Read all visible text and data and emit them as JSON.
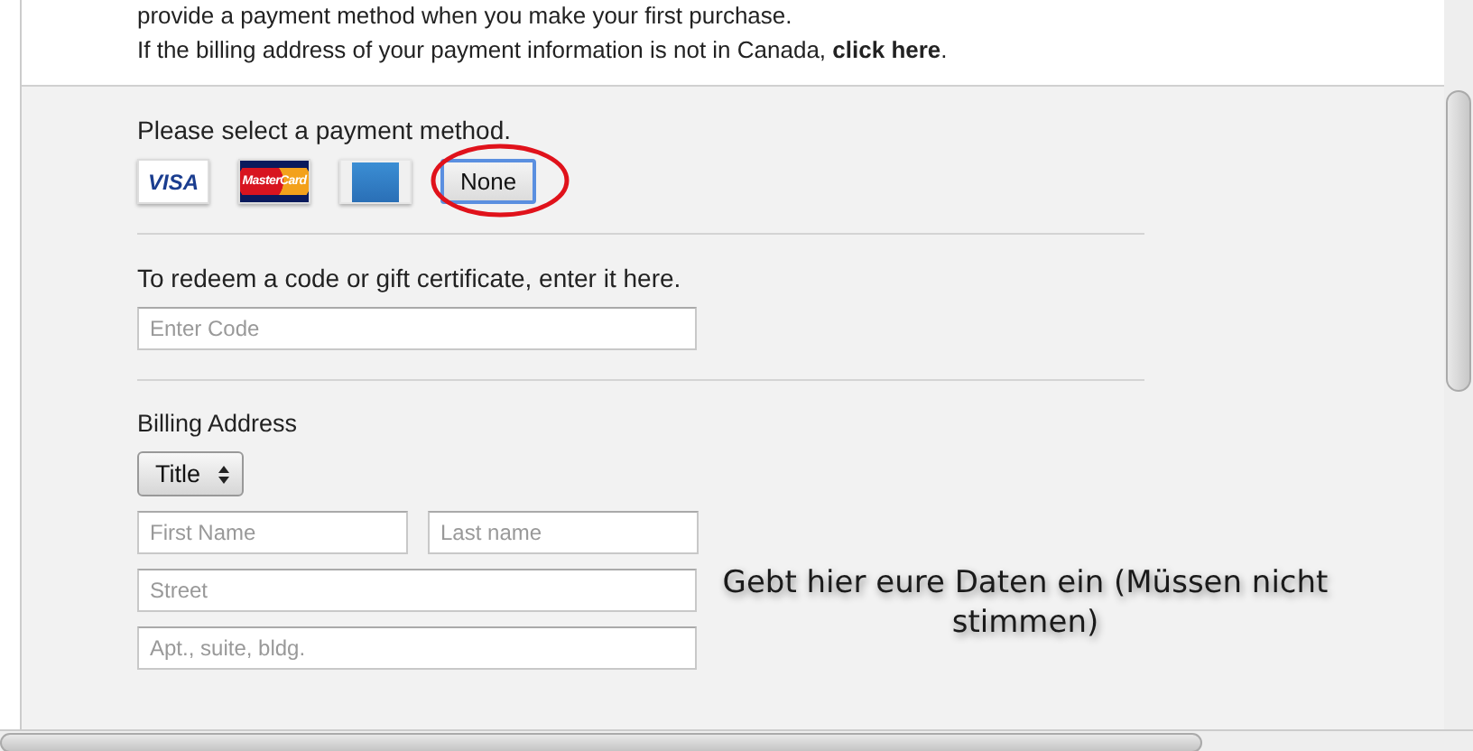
{
  "intro": {
    "line_1": "provide a payment method when you make your first purchase.",
    "line_2": "If the billing address of your payment information is not in Canada, **click here**."
  },
  "payment": {
    "label": "Please select a payment method.",
    "methods": [
      {
        "kind": "visa",
        "label": "VISA",
        "selected": false
      },
      {
        "kind": "mastercard",
        "label": "MasterCard",
        "selected": false
      },
      {
        "kind": "amex",
        "selected": false
      },
      {
        "kind": "none",
        "label": "None",
        "selected": true
      }
    ]
  },
  "redeem": {
    "label": "To redeem a code or gift certificate, enter it here.",
    "placeholder": "Enter Code"
  },
  "billing": {
    "heading": "Billing Address",
    "title_select": "Title",
    "first_name": {
      "placeholder": "First Name"
    },
    "last_name": {
      "placeholder": "Last name"
    },
    "street": {
      "placeholder": "Street"
    },
    "apt": {
      "placeholder": "Apt., suite, bldg."
    }
  },
  "annotation": {
    "text": "Gebt hier eure Daten ein (Müssen nicht stimmen)"
  }
}
